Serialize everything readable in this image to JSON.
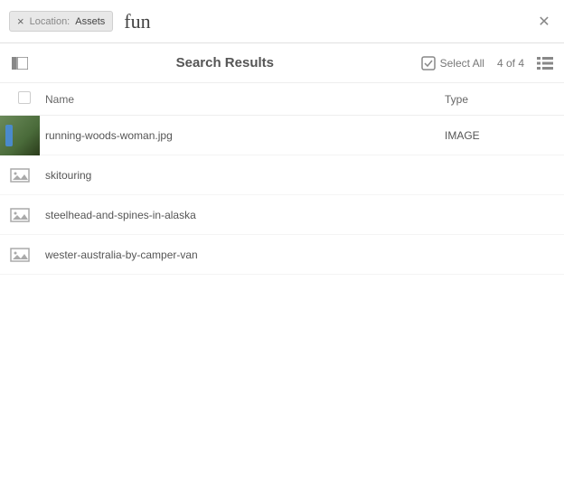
{
  "search": {
    "chip_label": "Location:",
    "chip_value": "Assets",
    "query": "fun"
  },
  "toolbar": {
    "title": "Search Results",
    "select_all": "Select All",
    "count": "4 of 4"
  },
  "columns": {
    "name": "Name",
    "type": "Type"
  },
  "results": [
    {
      "name": "running-woods-woman.jpg",
      "type": "IMAGE",
      "kind": "image"
    },
    {
      "name": "skitouring",
      "type": "",
      "kind": "folder"
    },
    {
      "name": "steelhead-and-spines-in-alaska",
      "type": "",
      "kind": "folder"
    },
    {
      "name": "wester-australia-by-camper-van",
      "type": "",
      "kind": "folder"
    }
  ]
}
